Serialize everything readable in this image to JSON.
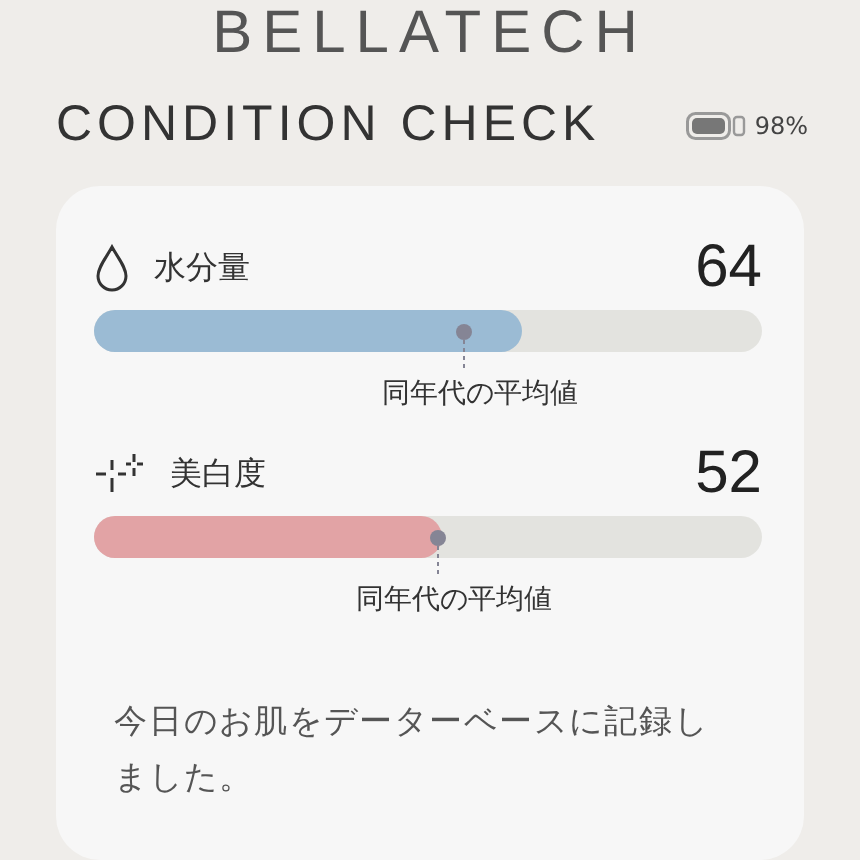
{
  "brand": "BELLATECH",
  "title": "CONDITION CHECK",
  "battery": "98%",
  "metrics": [
    {
      "kind": "drop",
      "label": "水分量",
      "value": "64",
      "level": 0.64,
      "color": "#9bbbd4",
      "average": {
        "label": "同年代の平均値",
        "level": 0.555
      }
    },
    {
      "kind": "sparkle",
      "label": "美白度",
      "value": "52",
      "level": 0.52,
      "color": "#e2a3a5",
      "average": {
        "label": "同年代の平均値",
        "level": 0.515
      }
    }
  ],
  "message": "今日のお肌をデーターベースに記録しました。"
}
